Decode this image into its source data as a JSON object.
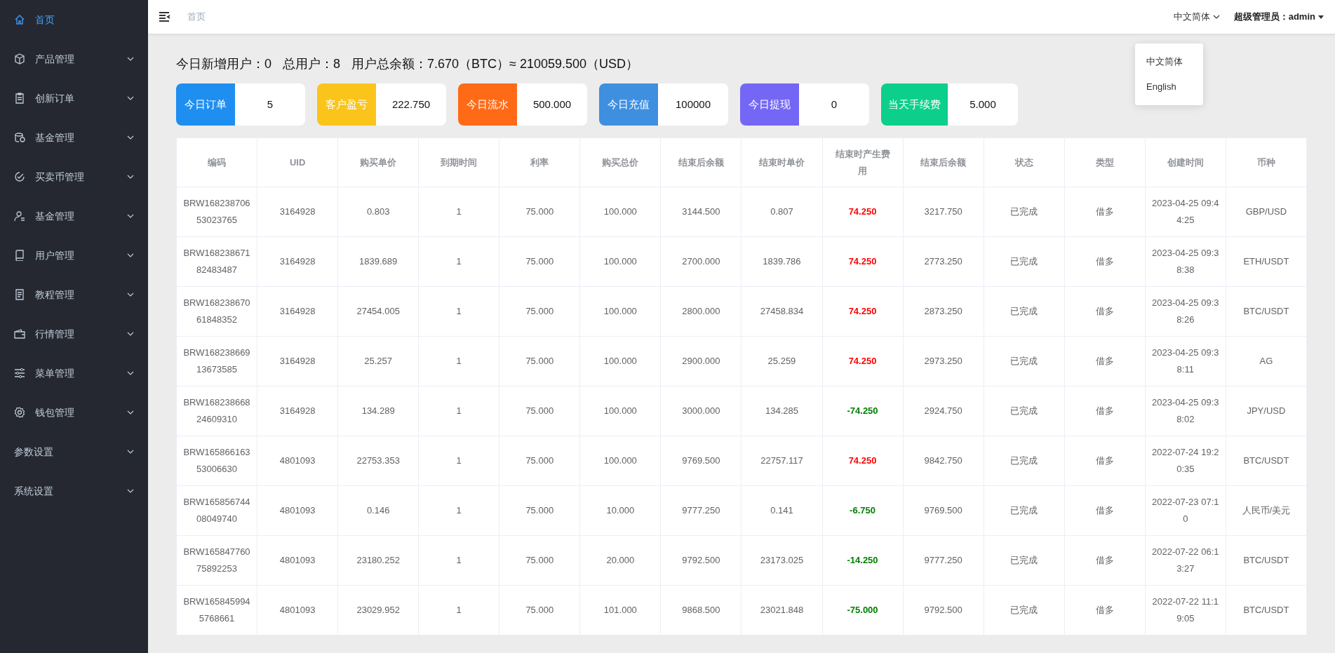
{
  "sidebar": {
    "items": [
      {
        "label": "首页",
        "selected": true,
        "expandable": false
      },
      {
        "label": "产品管理",
        "selected": false,
        "expandable": true
      },
      {
        "label": "创新订单",
        "selected": false,
        "expandable": true
      },
      {
        "label": "基金管理",
        "selected": false,
        "expandable": true
      },
      {
        "label": "买卖币管理",
        "selected": false,
        "expandable": true
      },
      {
        "label": "基金管理",
        "selected": false,
        "expandable": true
      },
      {
        "label": "用户管理",
        "selected": false,
        "expandable": true
      },
      {
        "label": "教程管理",
        "selected": false,
        "expandable": true
      },
      {
        "label": "行情管理",
        "selected": false,
        "expandable": true
      },
      {
        "label": "菜单管理",
        "selected": false,
        "expandable": true
      },
      {
        "label": "钱包管理",
        "selected": false,
        "expandable": true
      },
      {
        "label": "参数设置",
        "selected": false,
        "expandable": true
      },
      {
        "label": "系统设置",
        "selected": false,
        "expandable": true
      }
    ]
  },
  "header": {
    "breadcrumb": "首页",
    "language": "中文简体",
    "user": "超级管理员：admin",
    "language_menu": [
      "中文简体",
      "English"
    ]
  },
  "summary": [
    {
      "label": "今日新增用户：",
      "value": "0"
    },
    {
      "label": "总用户：",
      "value": "8"
    },
    {
      "label": "用户总余额：",
      "value": "7.670（BTC）≈ 210059.500（USD）"
    }
  ],
  "stats": [
    {
      "label": "今日订单",
      "value": "5",
      "color": "#1f8ef1"
    },
    {
      "label": "客户盈亏",
      "value": "222.750",
      "color": "#fbc41b"
    },
    {
      "label": "今日流水",
      "value": "500.000",
      "color": "#ff6a16"
    },
    {
      "label": "今日充值",
      "value": "100000",
      "color": "#3f8fe0"
    },
    {
      "label": "今日提现",
      "value": "0",
      "color": "#7467f5"
    },
    {
      "label": "当天手续费",
      "value": "5.000",
      "color": "#0ccf8c"
    }
  ],
  "table": {
    "columns": [
      "编码",
      "UID",
      "购买单价",
      "到期时间",
      "利率",
      "购买总价",
      "结束后余额",
      "结束时单价",
      "结束时产生费用",
      "结束后余额",
      "状态",
      "类型",
      "创建时间",
      "币种"
    ],
    "rows": [
      {
        "cells": [
          "BRW16823870653023765",
          "3164928",
          "0.803",
          "1",
          "75.000",
          "100.000",
          "3144.500",
          "0.807",
          "74.250",
          "3217.750",
          "已完成",
          "借多",
          "2023-04-25 09:44:25",
          "GBP/USD"
        ],
        "kind": "profit"
      },
      {
        "cells": [
          "BRW16823867182483487",
          "3164928",
          "1839.689",
          "1",
          "75.000",
          "100.000",
          "2700.000",
          "1839.786",
          "74.250",
          "2773.250",
          "已完成",
          "借多",
          "2023-04-25 09:38:38",
          "ETH/USDT"
        ],
        "kind": "profit"
      },
      {
        "cells": [
          "BRW16823867061848352",
          "3164928",
          "27454.005",
          "1",
          "75.000",
          "100.000",
          "2800.000",
          "27458.834",
          "74.250",
          "2873.250",
          "已完成",
          "借多",
          "2023-04-25 09:38:26",
          "BTC/USDT"
        ],
        "kind": "profit"
      },
      {
        "cells": [
          "BRW16823866913673585",
          "3164928",
          "25.257",
          "1",
          "75.000",
          "100.000",
          "2900.000",
          "25.259",
          "74.250",
          "2973.250",
          "已完成",
          "借多",
          "2023-04-25 09:38:11",
          "AG"
        ],
        "kind": "profit"
      },
      {
        "cells": [
          "BRW16823866824609310",
          "3164928",
          "134.289",
          "1",
          "75.000",
          "100.000",
          "3000.000",
          "134.285",
          "-74.250",
          "2924.750",
          "已完成",
          "借多",
          "2023-04-25 09:38:02",
          "JPY/USD"
        ],
        "kind": "loss"
      },
      {
        "cells": [
          "BRW16586616353006630",
          "4801093",
          "22753.353",
          "1",
          "75.000",
          "100.000",
          "9769.500",
          "22757.117",
          "74.250",
          "9842.750",
          "已完成",
          "借多",
          "2022-07-24 19:20:35",
          "BTC/USDT"
        ],
        "kind": "profit"
      },
      {
        "cells": [
          "BRW16585674408049740",
          "4801093",
          "0.146",
          "1",
          "75.000",
          "10.000",
          "9777.250",
          "0.141",
          "-6.750",
          "9769.500",
          "已完成",
          "借多",
          "2022-07-23 07:10",
          "人民币/美元"
        ],
        "kind": "loss"
      },
      {
        "cells": [
          "BRW16584776075892253",
          "4801093",
          "23180.252",
          "1",
          "75.000",
          "20.000",
          "9792.500",
          "23173.025",
          "-14.250",
          "9777.250",
          "已完成",
          "借多",
          "2022-07-22 06:13:27",
          "BTC/USDT"
        ],
        "kind": "loss"
      },
      {
        "cells": [
          "BRW1658459945768661",
          "4801093",
          "23029.952",
          "1",
          "75.000",
          "101.000",
          "9868.500",
          "23021.848",
          "-75.000",
          "9792.500",
          "已完成",
          "借多",
          "2022-07-22 11:19:05",
          "BTC/USDT"
        ],
        "kind": "loss"
      }
    ]
  }
}
